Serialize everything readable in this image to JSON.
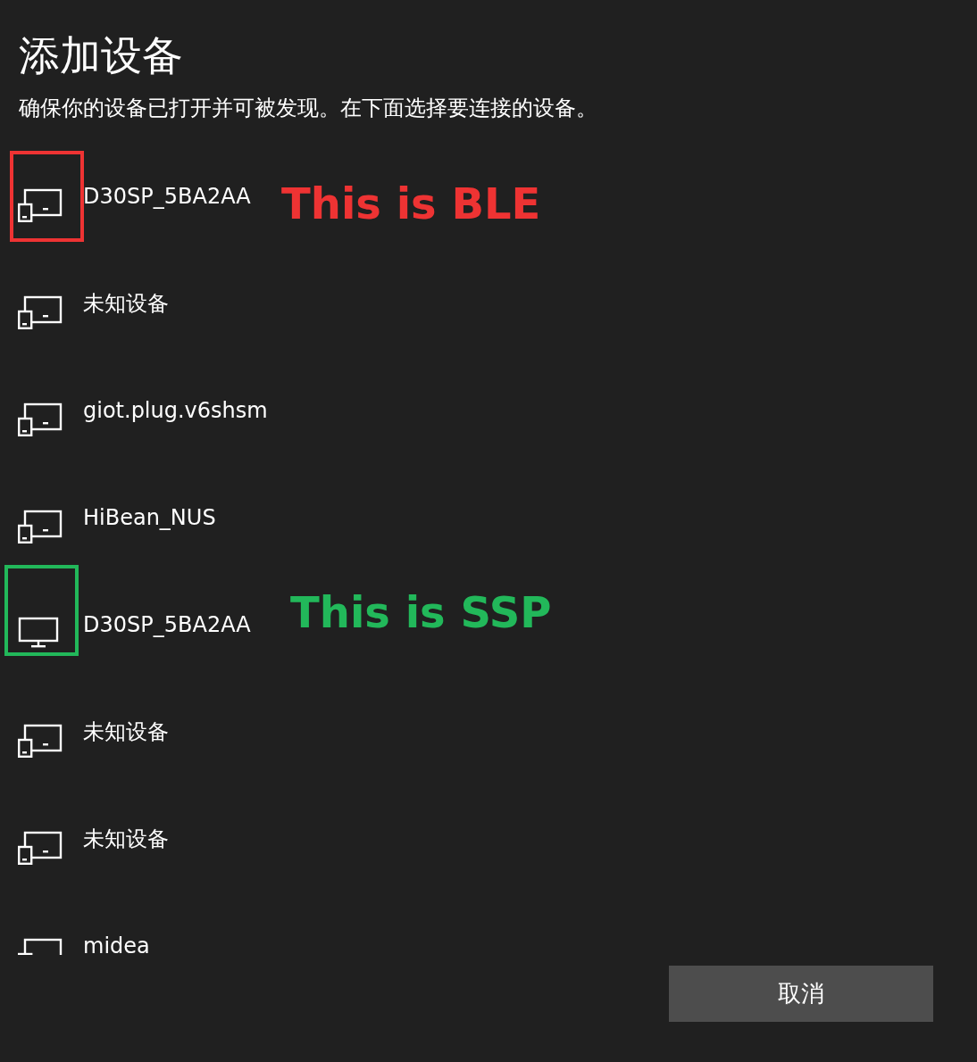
{
  "title": "添加设备",
  "subtitle": "确保你的设备已打开并可被发现。在下面选择要连接的设备。",
  "devices": [
    {
      "kind": "device",
      "name": "D30SP_5BA2AA",
      "annotation": {
        "text": "This is BLE",
        "color": "#ee3333"
      }
    },
    {
      "kind": "device",
      "name": "未知设备"
    },
    {
      "kind": "device",
      "name": "giot.plug.v6shsm"
    },
    {
      "kind": "device",
      "name": "HiBean_NUS"
    },
    {
      "kind": "monitor",
      "name": "D30SP_5BA2AA",
      "annotation": {
        "text": "This is SSP",
        "color": "#22b85a"
      }
    },
    {
      "kind": "device",
      "name": "未知设备"
    },
    {
      "kind": "device",
      "name": "未知设备"
    },
    {
      "kind": "device",
      "name": "midea"
    }
  ],
  "cancel_button": "取消"
}
